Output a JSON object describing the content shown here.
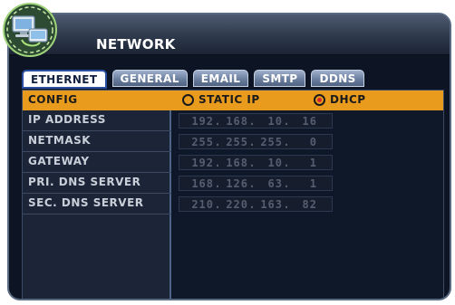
{
  "window": {
    "title": "NETWORK",
    "icon": "network-computer-icon"
  },
  "tabs": [
    {
      "label": "ETHERNET",
      "active": true
    },
    {
      "label": "GENERAL",
      "active": false
    },
    {
      "label": "EMAIL",
      "active": false
    },
    {
      "label": "SMTP",
      "active": false
    },
    {
      "label": "DDNS",
      "active": false
    }
  ],
  "config": {
    "label": "CONFIG",
    "options": [
      {
        "label": "STATIC IP",
        "selected": false
      },
      {
        "label": "DHCP",
        "selected": true
      }
    ]
  },
  "fields": [
    {
      "label": "IP ADDRESS",
      "octets": [
        "192",
        "168",
        "10",
        "16"
      ]
    },
    {
      "label": "NETMASK",
      "octets": [
        "255",
        "255",
        "255",
        "0"
      ]
    },
    {
      "label": "GATEWAY",
      "octets": [
        "192",
        "168",
        "10",
        "1"
      ]
    },
    {
      "label": "PRI. DNS SERVER",
      "octets": [
        "168",
        "126",
        "63",
        "1"
      ]
    },
    {
      "label": "SEC. DNS SERVER",
      "octets": [
        "210",
        "220",
        "163",
        "82"
      ]
    }
  ],
  "colors": {
    "highlight_row": "#e89b1c",
    "radio_selected": "#d7262c",
    "active_tab_border": "#2b4fa0"
  }
}
